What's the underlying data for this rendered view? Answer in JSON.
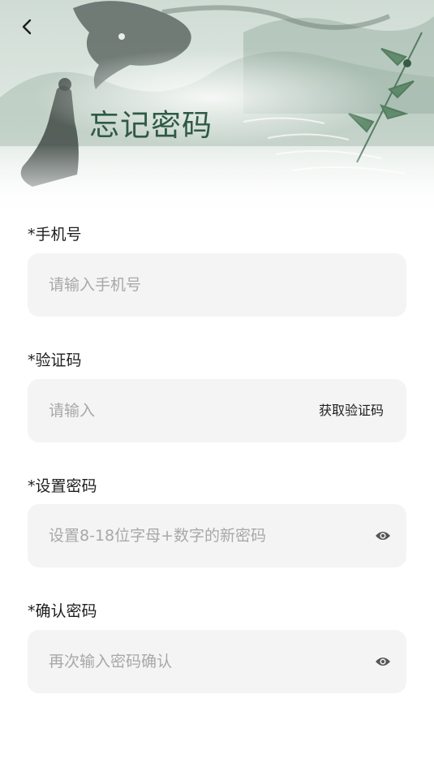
{
  "header": {
    "title": "忘记密码",
    "back_icon": "chevron-left-icon"
  },
  "form": {
    "phone": {
      "label": "*手机号",
      "placeholder": "请输入手机号",
      "value": ""
    },
    "code": {
      "label": "*验证码",
      "placeholder": "请输入",
      "value": "",
      "get_code_label": "获取验证码"
    },
    "password": {
      "label": "*设置密码",
      "placeholder": "设置8-18位字母+数字的新密码",
      "value": "",
      "toggle_icon": "eye-icon"
    },
    "confirm": {
      "label": "*确认密码",
      "placeholder": "再次输入密码确认",
      "value": "",
      "toggle_icon": "eye-icon"
    }
  },
  "colors": {
    "title": "#2f5a45",
    "field_bg": "#f4f4f4",
    "placeholder": "#a8a8a8",
    "text": "#1e1e1e",
    "eye_icon": "#555555"
  }
}
